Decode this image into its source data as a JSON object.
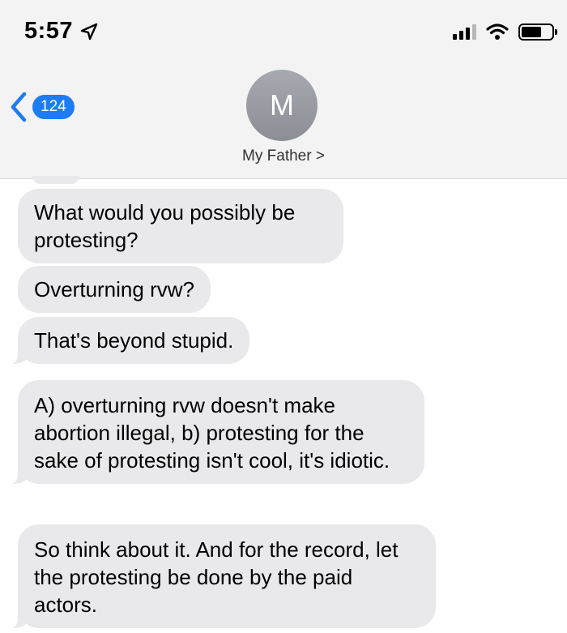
{
  "status_bar": {
    "time": "5:57"
  },
  "nav": {
    "back_count": "124"
  },
  "contact": {
    "initial": "M",
    "name": "My Father >"
  },
  "messages": [
    "What would you possibly be protesting?",
    "Overturning  rvw?",
    "That's beyond stupid.",
    "A) overturning rvw doesn't make abortion illegal, b) protesting for the sake of protesting isn't cool, it's idiotic.",
    "So think about it.  And for the record, let the protesting be done by the paid actors."
  ],
  "colors": {
    "bubble": "#e9e9eb",
    "accent": "#1e7cf2",
    "header": "#f3f3f4"
  }
}
